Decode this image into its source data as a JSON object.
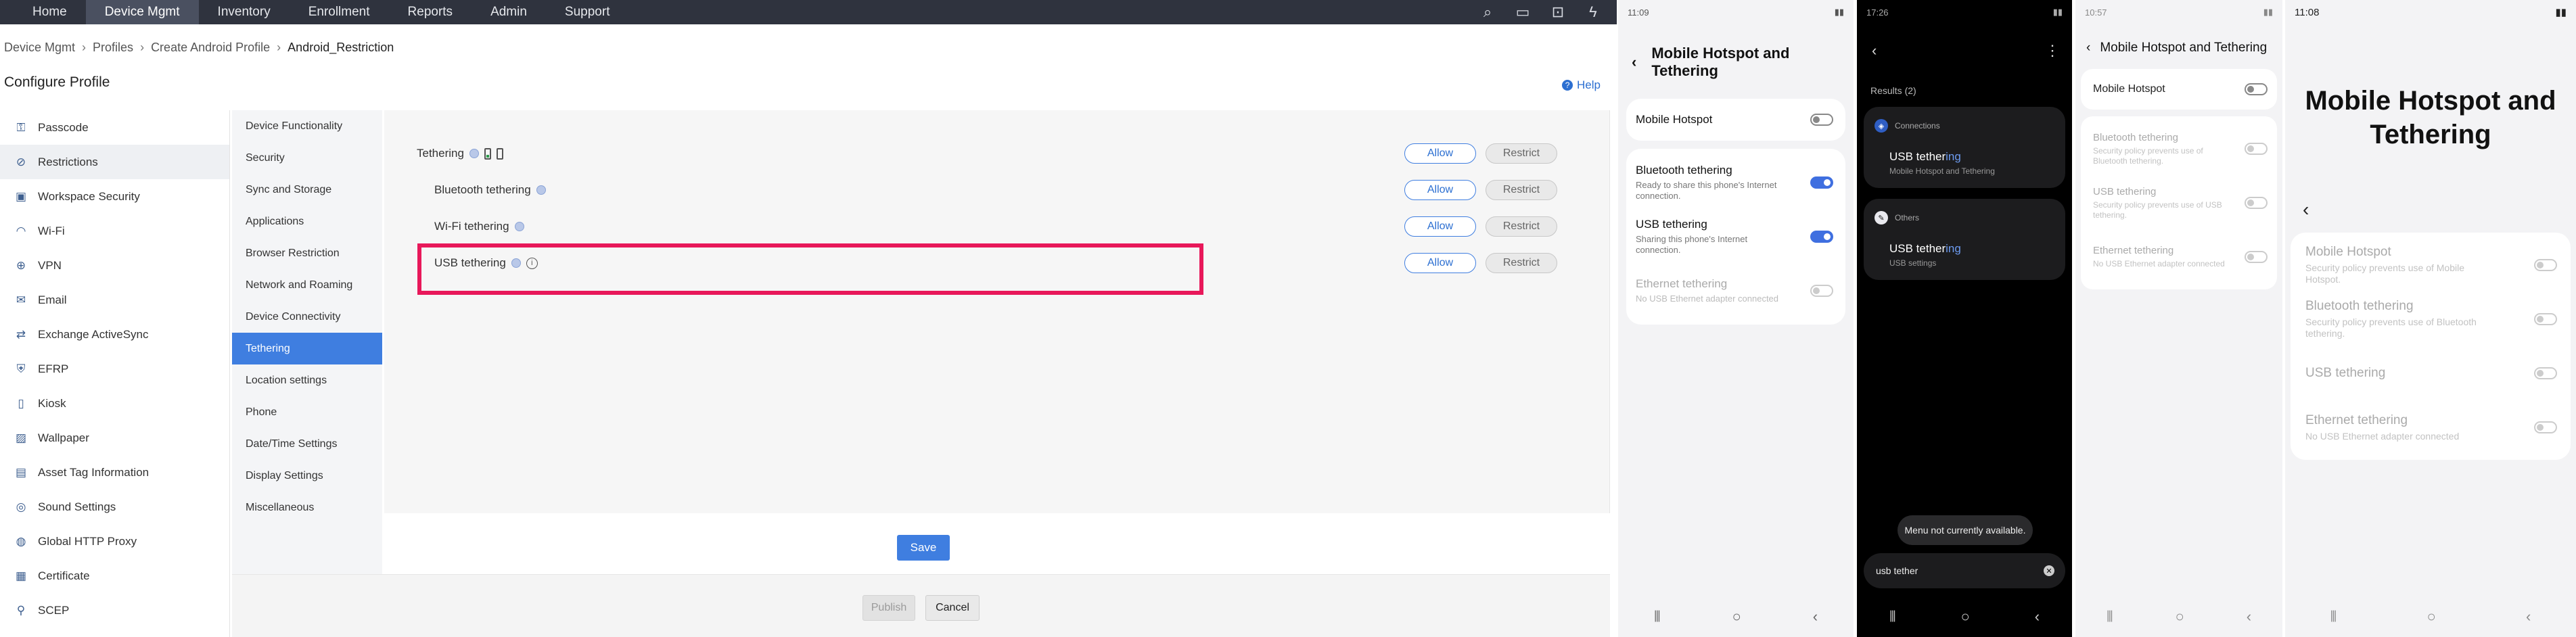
{
  "topnav": {
    "items": [
      "Home",
      "Device Mgmt",
      "Inventory",
      "Enrollment",
      "Reports",
      "Admin",
      "Support"
    ],
    "icons": [
      "search-icon",
      "video-icon",
      "lock-icon",
      "bolt-icon"
    ]
  },
  "breadcrumb": [
    "Device Mgmt",
    "Profiles",
    "Create Android Profile",
    "Android_Restriction"
  ],
  "page_title": "Configure Profile",
  "help_label": "Help",
  "sidebar": [
    {
      "label": "Passcode",
      "icon": "passcode-icon"
    },
    {
      "label": "Restrictions",
      "icon": "restrictions-icon"
    },
    {
      "label": "Workspace Security",
      "icon": "workspace-security-icon"
    },
    {
      "label": "Wi-Fi",
      "icon": "wifi-icon"
    },
    {
      "label": "VPN",
      "icon": "vpn-icon"
    },
    {
      "label": "Email",
      "icon": "email-icon"
    },
    {
      "label": "Exchange ActiveSync",
      "icon": "exchange-icon"
    },
    {
      "label": "EFRP",
      "icon": "efrp-icon"
    },
    {
      "label": "Kiosk",
      "icon": "kiosk-icon"
    },
    {
      "label": "Wallpaper",
      "icon": "wallpaper-icon"
    },
    {
      "label": "Asset Tag Information",
      "icon": "asset-tag-icon"
    },
    {
      "label": "Sound Settings",
      "icon": "sound-icon"
    },
    {
      "label": "Global HTTP Proxy",
      "icon": "proxy-icon"
    },
    {
      "label": "Certificate",
      "icon": "certificate-icon"
    },
    {
      "label": "SCEP",
      "icon": "scep-icon"
    }
  ],
  "subnav": [
    "Device Functionality",
    "Security",
    "Sync and Storage",
    "Applications",
    "Browser Restriction",
    "Network and Roaming",
    "Device Connectivity",
    "Tethering",
    "Location settings",
    "Phone",
    "Date/Time Settings",
    "Display Settings",
    "Miscellaneous"
  ],
  "tethering_rows": [
    {
      "label": "Tethering"
    },
    {
      "label": "Bluetooth tethering"
    },
    {
      "label": "Wi-Fi tethering"
    },
    {
      "label": "USB tethering"
    }
  ],
  "buttons": {
    "allow": "Allow",
    "restrict": "Restrict",
    "save": "Save",
    "publish": "Publish",
    "cancel": "Cancel"
  },
  "colors": {
    "accent": "#3f7ee0",
    "highlight": "#e8185a",
    "topnav": "#2f333e"
  },
  "phone1": {
    "time": "11:09",
    "title": "Mobile Hotspot and Tethering",
    "hotspot": "Mobile Hotspot",
    "options": [
      {
        "title": "Bluetooth tethering",
        "sub": "Ready to share this phone's Internet connection.",
        "state": "on"
      },
      {
        "title": "USB tethering",
        "sub": "Sharing this phone's Internet connection.",
        "state": "on"
      },
      {
        "title": "Ethernet tethering",
        "sub": "No USB Ethernet adapter connected",
        "state": "disabled"
      }
    ]
  },
  "phone2": {
    "time": "17:26",
    "results": "Results (2)",
    "groups": [
      {
        "category": "Connections",
        "title_prefix": "USB tether",
        "title_suffix": "ing",
        "sub": "Mobile Hotspot and Tethering"
      },
      {
        "category": "Others",
        "title_prefix": "USB tether",
        "title_suffix": "ing",
        "sub": "USB settings"
      }
    ],
    "toast": "Menu not currently available.",
    "search_text": "usb tether"
  },
  "phone3": {
    "time": "10:57",
    "title": "Mobile Hotspot and Tethering",
    "hotspot": "Mobile Hotspot",
    "options": [
      {
        "title": "Bluetooth tethering",
        "sub": "Security policy prevents use of Bluetooth tethering."
      },
      {
        "title": "USB tethering",
        "sub": "Security policy prevents use of USB tethering."
      },
      {
        "title": "Ethernet tethering",
        "sub": "No USB Ethernet adapter connected"
      }
    ]
  },
  "phone4": {
    "time": "11:08",
    "title_line1": "Mobile Hotspot and",
    "title_line2": "Tethering",
    "options": [
      {
        "title": "Mobile Hotspot",
        "sub": "Security policy prevents use of Mobile Hotspot."
      },
      {
        "title": "Bluetooth tethering",
        "sub": "Security policy prevents use of Bluetooth tethering."
      },
      {
        "title": "USB tethering",
        "sub": ""
      },
      {
        "title": "Ethernet tethering",
        "sub": "No USB Ethernet adapter connected"
      }
    ]
  }
}
